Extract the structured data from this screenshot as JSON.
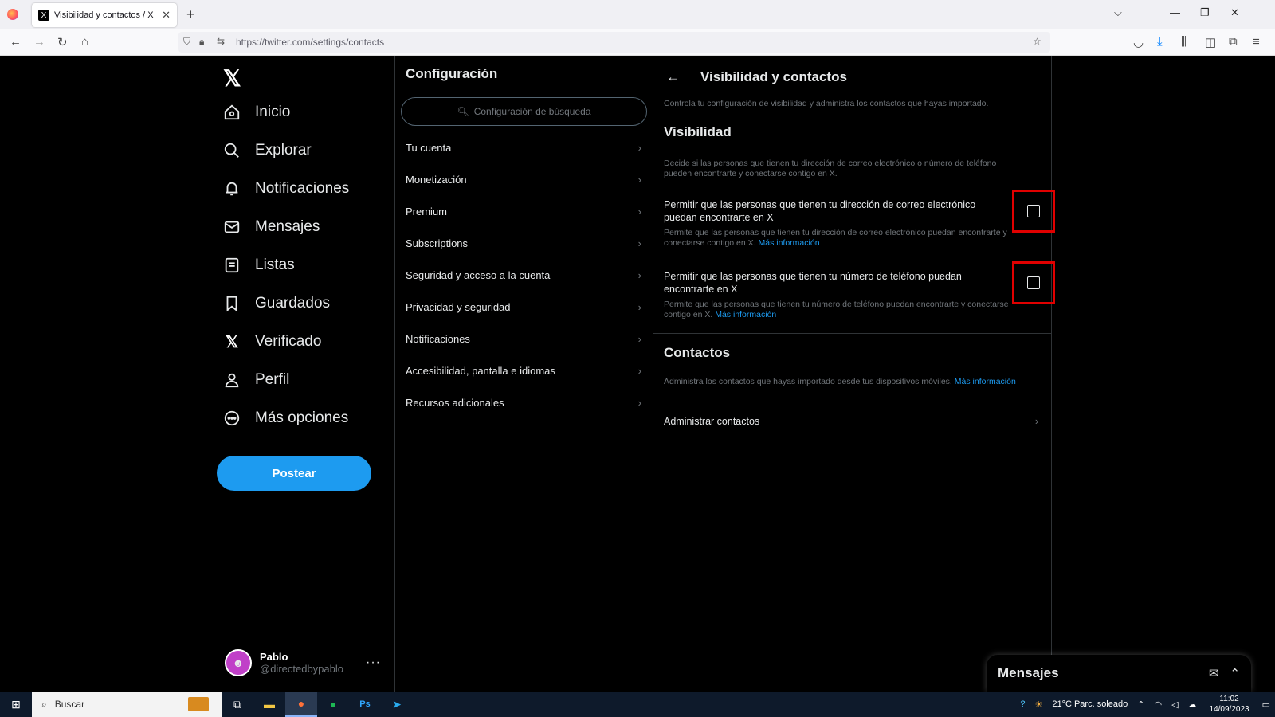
{
  "browser": {
    "tab_title": "Visibilidad y contactos / X",
    "tab_close": "✕",
    "new_tab": "+",
    "url": "https://twitter.com/settings/contacts",
    "icons": [
      "firefox-icon",
      "back-icon",
      "forward-icon",
      "reload-icon",
      "home-icon",
      "shield-icon",
      "lock-icon",
      "bookmark-star-icon",
      "pocket-icon",
      "download-icon",
      "library-icon",
      "sidebar-icon",
      "extensions-icon",
      "menu-icon"
    ]
  },
  "nav": {
    "items": [
      {
        "label": "Inicio",
        "icon": "home-icon"
      },
      {
        "label": "Explorar",
        "icon": "search-icon"
      },
      {
        "label": "Notificaciones",
        "icon": "bell-icon"
      },
      {
        "label": "Mensajes",
        "icon": "envelope-icon"
      },
      {
        "label": "Listas",
        "icon": "list-icon"
      },
      {
        "label": "Guardados",
        "icon": "bookmark-icon"
      },
      {
        "label": "Verificado",
        "icon": "x-verified-icon"
      },
      {
        "label": "Perfil",
        "icon": "person-icon"
      },
      {
        "label": "Más opciones",
        "icon": "more-circle-icon"
      }
    ],
    "post_button": "Postear",
    "profile": {
      "name": "Pablo",
      "handle": "@directedbypablo",
      "more": "···"
    }
  },
  "settings": {
    "title": "Configuración",
    "search_placeholder": "Configuración de búsqueda",
    "items": [
      "Tu cuenta",
      "Monetización",
      "Premium",
      "Subscriptions",
      "Seguridad y acceso a la cuenta",
      "Privacidad y seguridad",
      "Notificaciones",
      "Accesibilidad, pantalla e idiomas",
      "Recursos adicionales"
    ]
  },
  "detail": {
    "title": "Visibilidad y contactos",
    "intro": "Controla tu configuración de visibilidad y administra los contactos que hayas importado.",
    "visibility": {
      "title": "Visibilidad",
      "desc": "Decide si las personas que tienen tu dirección de correo electrónico o número de teléfono pueden encontrarte y conectarse contigo en X.",
      "email_option": {
        "title": "Permitir que las personas que tienen tu dirección de correo electrónico puedan encontrarte en X",
        "desc": "Permite que las personas que tienen tu dirección de correo electrónico puedan encontrarte y conectarse contigo en X.",
        "link": "Más información",
        "checked": false
      },
      "phone_option": {
        "title": "Permitir que las personas que tienen tu número de teléfono puedan encontrarte en X",
        "desc": "Permite que las personas que tienen tu número de teléfono puedan encontrarte y conectarse contigo en X.",
        "link": "Más información",
        "checked": false
      }
    },
    "contacts": {
      "title": "Contactos",
      "desc": "Administra los contactos que hayas importado desde tus dispositivos móviles.",
      "link": "Más información",
      "manage": "Administrar contactos"
    }
  },
  "messages_drawer": {
    "title": "Mensajes"
  },
  "taskbar": {
    "search": "Buscar",
    "weather": "21°C  Parc. soleado",
    "time": "11:02",
    "date": "14/09/2023"
  },
  "colors": {
    "accent": "#1d9bf0",
    "highlight": "#e00000",
    "background": "#000000"
  }
}
